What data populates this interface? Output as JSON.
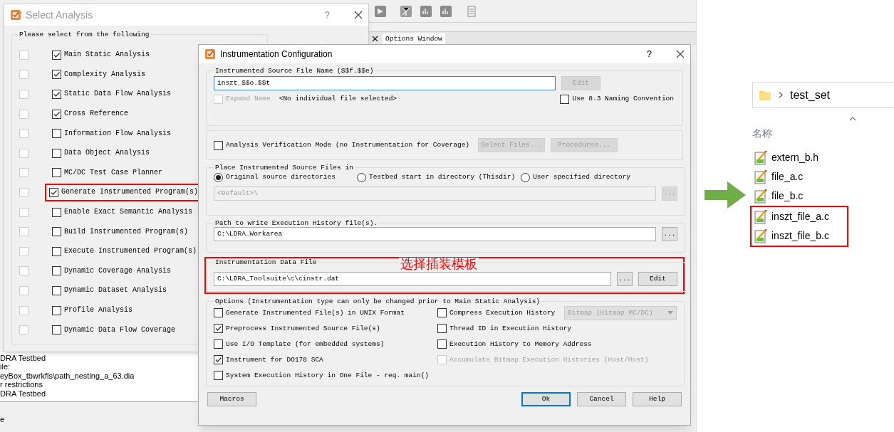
{
  "app": {
    "panel_tab": "Options Window",
    "log_lines": [
      "DRA Testbed",
      "ile:",
      "eyBox_tbwrkfls\\path_nesting_a_63.dia",
      "r restrictions",
      "DRA Testbed"
    ],
    "status_text": "e"
  },
  "select_dialog": {
    "title": "Select Analysis",
    "help": "?",
    "group": "Please select from the following",
    "items": [
      {
        "label": "Main Static Analysis",
        "side_checked": false,
        "checked": true,
        "highlighted": false
      },
      {
        "label": "Complexity Analysis",
        "side_checked": false,
        "checked": true,
        "highlighted": false
      },
      {
        "label": "Static Data Flow Analysis",
        "side_checked": false,
        "checked": true,
        "highlighted": false
      },
      {
        "label": "Cross Reference",
        "side_checked": false,
        "checked": true,
        "highlighted": false
      },
      {
        "label": "Information Flow Analysis",
        "side_checked": false,
        "checked": false,
        "highlighted": false
      },
      {
        "label": "Data Object Analysis",
        "side_checked": false,
        "checked": false,
        "highlighted": false
      },
      {
        "label": "MC/DC Test Case Planner",
        "side_checked": false,
        "checked": false,
        "highlighted": false
      },
      {
        "label": "Generate Instrumented Program(s)",
        "side_checked": false,
        "checked": true,
        "highlighted": true
      },
      {
        "label": "Enable Exact Semantic Analysis",
        "side_checked": false,
        "checked": false,
        "highlighted": false
      },
      {
        "label": "Build Instrumented Program(s)",
        "side_checked": false,
        "checked": false,
        "highlighted": false
      },
      {
        "label": "Execute Instrumented Program(s)",
        "side_checked": false,
        "checked": false,
        "highlighted": false
      },
      {
        "label": "Dynamic Coverage Analysis",
        "side_checked": false,
        "checked": false,
        "highlighted": false
      },
      {
        "label": "Dynamic Dataset Analysis",
        "side_checked": false,
        "checked": false,
        "highlighted": false
      },
      {
        "label": "Profile Analysis",
        "side_checked": false,
        "checked": false,
        "highlighted": false
      },
      {
        "label": "Dynamic Data Flow Coverage",
        "side_checked": false,
        "checked": false,
        "highlighted": false
      }
    ]
  },
  "config_dialog": {
    "title": "Instrumentation Configuration",
    "help": "?",
    "file_name": {
      "legend": "Instrumented Source File Name ($$f.$$e)",
      "value": "inszt_$$o.$$t",
      "edit_button": {
        "label": "Edit",
        "disabled": true
      },
      "expand_name": {
        "label": "Expand Name",
        "checked": false,
        "disabled": true
      },
      "note": "<No individual file selected>",
      "naming": {
        "label": "Use 8.3 Naming Convention",
        "checked": false,
        "disabled": false
      }
    },
    "verification": {
      "label": "Analysis Verification Mode (no Instrumentation for Coverage)",
      "checked": false,
      "buttons": [
        {
          "label": "Select Files...",
          "disabled": true
        },
        {
          "label": "Procedures...",
          "disabled": true
        }
      ]
    },
    "place": {
      "legend": "Place Instrumented Source Files in",
      "radios": [
        {
          "label": "Original source directories",
          "selected": true
        },
        {
          "label": "Testbed start in directory (Thisdir)",
          "selected": false
        },
        {
          "label": "User specified directory",
          "selected": false
        }
      ],
      "value": "<Default>\\",
      "disabled": true,
      "browse": "..."
    },
    "history_path": {
      "legend": "Path to write Execution History file(s).",
      "value": "C:\\LDRA_Workarea",
      "browse": "..."
    },
    "data_file": {
      "legend": "Instrumentation Data File",
      "value": "C:\\LDRA_Toolsuite\\c\\cinstr.dat",
      "browse": "...",
      "edit": "Edit",
      "annotation": "选择插装模板",
      "highlighted": true
    },
    "options": {
      "legend": "Options (Instrumentation type can only be changed prior to Main Static Analysis)",
      "left": [
        {
          "label": "Generate Instrumented File(s) in UNIX Format",
          "checked": false,
          "disabled": false
        },
        {
          "label": "Preprocess Instrumented Source File(s)",
          "checked": true,
          "disabled": false
        },
        {
          "label": "Use I/O Template (for embedded systems)",
          "checked": false,
          "disabled": false
        },
        {
          "label": "Instrument for DO178 SCA",
          "checked": true,
          "disabled": false
        },
        {
          "label": "System Execution History in One File - req. main()",
          "checked": false,
          "disabled": false
        }
      ],
      "right": [
        {
          "label": "Compress Execution History",
          "checked": false,
          "disabled": false,
          "dropdown": {
            "value": "Bitmap (Hitmap MC/DC)",
            "disabled": true
          }
        },
        {
          "label": "Thread ID in Execution History",
          "checked": false,
          "disabled": false
        },
        {
          "label": "Execution History to Memory Address",
          "checked": false,
          "disabled": false
        },
        {
          "label": "Accumulate Bitmap Execution Histories (Host/Host)",
          "checked": false,
          "disabled": true
        }
      ]
    },
    "buttons": [
      {
        "label": "Macros",
        "default": false
      },
      {
        "label": "Ok",
        "default": true
      },
      {
        "label": "Cancel",
        "default": false
      },
      {
        "label": "Help",
        "default": false
      }
    ]
  },
  "explorer": {
    "path": "test_set",
    "column": "名称",
    "files": [
      {
        "name": "extern_b.h",
        "highlighted": false
      },
      {
        "name": "file_a.c",
        "highlighted": false
      },
      {
        "name": "file_b.c",
        "highlighted": false
      },
      {
        "name": "inszt_file_a.c",
        "highlighted": true
      },
      {
        "name": "inszt_file_b.c",
        "highlighted": true
      }
    ]
  }
}
